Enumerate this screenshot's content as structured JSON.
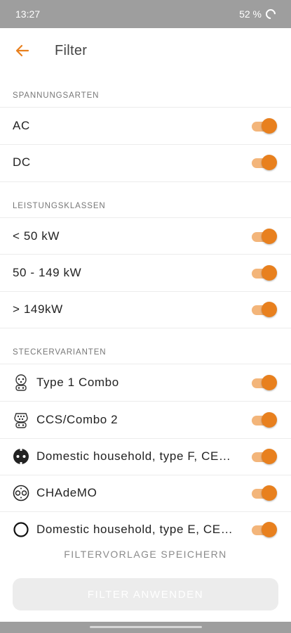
{
  "status_bar": {
    "time": "13:27",
    "battery": "52 %"
  },
  "header": {
    "title": "Filter"
  },
  "sections": {
    "voltage": {
      "title": "SPANNUNGSARTEN",
      "items": [
        {
          "label": "AC",
          "enabled": true
        },
        {
          "label": "DC",
          "enabled": true
        }
      ]
    },
    "power": {
      "title": "LEISTUNGSKLASSEN",
      "items": [
        {
          "label": "< 50 kW",
          "enabled": true
        },
        {
          "label": "50 - 149 kW",
          "enabled": true
        },
        {
          "label": "> 149kW",
          "enabled": true
        }
      ]
    },
    "plugs": {
      "title": "STECKERVARIANTEN",
      "items": [
        {
          "label": "Type 1 Combo",
          "icon": "type1-combo-plug-icon",
          "enabled": true
        },
        {
          "label": "CCS/Combo 2",
          "icon": "ccs-combo2-plug-icon",
          "enabled": true
        },
        {
          "label": "Domestic household, type F, CE…",
          "icon": "schuko-type-f-plug-icon",
          "enabled": true
        },
        {
          "label": "CHAdeMO",
          "icon": "chademo-plug-icon",
          "enabled": true
        },
        {
          "label": "Domestic household, type E, CE…",
          "icon": "type-e-plug-icon",
          "enabled": true
        }
      ]
    }
  },
  "actions": {
    "save_template": "FILTERVORLAGE SPEICHERN",
    "apply": "FILTER ANWENDEN"
  },
  "colors": {
    "accent": "#e8801e",
    "accent_light": "#f3b57a"
  }
}
